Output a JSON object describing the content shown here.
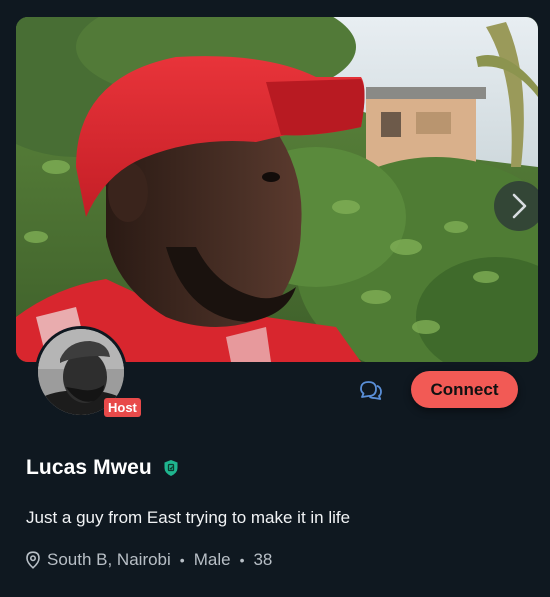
{
  "profile": {
    "name": "Lucas Mweu",
    "role_badge": "Host",
    "bio": "Just a guy from East trying to make it in life",
    "location": "South B, Nairobi",
    "gender": "Male",
    "age": "38",
    "meta_separator": "•"
  },
  "actions": {
    "connect_label": "Connect",
    "message_icon": "chat-bubbles-icon",
    "next_photo_icon": "chevron-right-icon"
  },
  "icons": {
    "verified": "verified-shield-icon",
    "location": "map-pin-icon"
  },
  "colors": {
    "background": "#0f1820",
    "accent": "#f25a55",
    "host_badge": "#e84a4a",
    "verified": "#1fb58f",
    "chat_icon": "#5a8fd8"
  }
}
